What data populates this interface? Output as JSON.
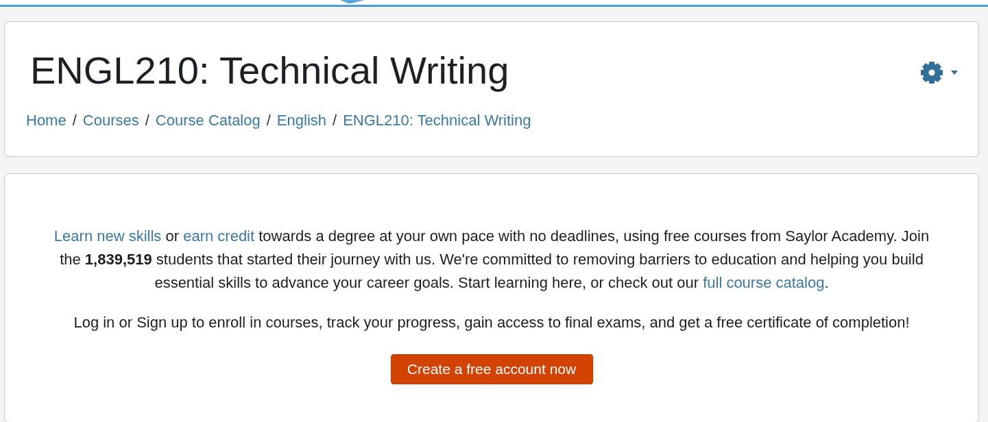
{
  "header": {
    "title": "ENGL210: Technical Writing",
    "breadcrumb": {
      "separator": "/",
      "items": [
        {
          "label": "Home"
        },
        {
          "label": "Courses"
        },
        {
          "label": "Course Catalog"
        },
        {
          "label": "English"
        },
        {
          "label": "ENGL210: Technical Writing"
        }
      ]
    }
  },
  "intro": {
    "paragraphs": [
      [
        {
          "kind": "link",
          "text": "Learn new skills"
        },
        {
          "kind": "text",
          "text": " or "
        },
        {
          "kind": "link",
          "text": "earn credit"
        },
        {
          "kind": "text",
          "text": " towards a degree at your own pace with no deadlines, using free courses from Saylor Academy. Join the **1,839,519** students that started their journey with us. We're committed to removing barriers to education and helping you build essential skills to advance your career goals. Start learning here, or check out our "
        },
        {
          "kind": "link",
          "text": "full course catalog"
        },
        {
          "kind": "text",
          "text": "."
        }
      ],
      [
        {
          "kind": "text",
          "text": "Log in or Sign up to enroll in courses, track your progress, gain access to final exams, and get a free certificate of completion!"
        }
      ]
    ],
    "button": "Create a free account now"
  }
}
